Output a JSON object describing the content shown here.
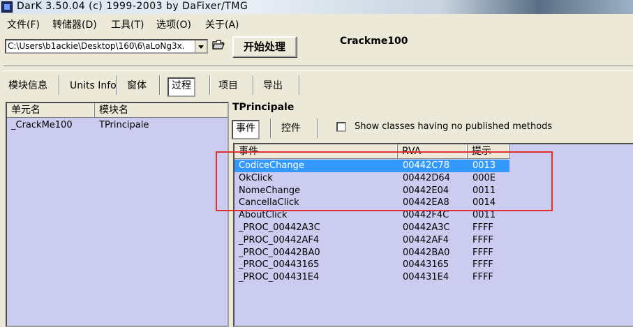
{
  "window": {
    "title": "DarK 3.50.04 (c) 1999-2003 by DaFixer/TMG"
  },
  "menu": [
    "文件(F)",
    "转储器(D)",
    "工具(T)",
    "选项(O)",
    "关于(A)"
  ],
  "toolbar": {
    "path": "C:\\Users\\b1ackie\\Desktop\\160\\6\\aLoNg3x.",
    "process_label": "开始处理",
    "project_name": "Crackme100"
  },
  "tabs": [
    "模块信息",
    "Units Info",
    "窗体",
    "过程",
    "项目",
    "导出"
  ],
  "left_table": {
    "headers": [
      "单元名",
      "模块名"
    ],
    "rows": [
      [
        "_CrackMe100",
        "TPrincipale"
      ]
    ]
  },
  "form_name": "TPrincipale",
  "sub_tabs": [
    "事件",
    "控件"
  ],
  "show_classes_label": "Show classes having no published methods",
  "events": {
    "headers": [
      "事件",
      "RVA",
      "提示"
    ],
    "rows": [
      [
        "CodiceChange",
        "00442C78",
        "0013"
      ],
      [
        "OkClick",
        "00442D64",
        "000E"
      ],
      [
        "NomeChange",
        "00442E04",
        "0011"
      ],
      [
        "CancellaClick",
        "00442EA8",
        "0014"
      ],
      [
        "AboutClick",
        "00442F4C",
        "0011"
      ],
      [
        "_PROC_00442A3C",
        "00442A3C",
        "FFFF"
      ],
      [
        "_PROC_00442AF4",
        "00442AF4",
        "FFFF"
      ],
      [
        "_PROC_00442BA0",
        "00442BA0",
        "FFFF"
      ],
      [
        "_PROC_00443165",
        "00443165",
        "FFFF"
      ],
      [
        "_PROC_004431E4",
        "004431E4",
        "FFFF"
      ]
    ]
  },
  "colors": {
    "list_bg": "#ccccf0",
    "selection": "#3399ff",
    "annotation": "#e03030"
  },
  "icons": {
    "app": "app-icon",
    "folder": "folder-open-icon",
    "combo": "chevron-down-icon"
  }
}
